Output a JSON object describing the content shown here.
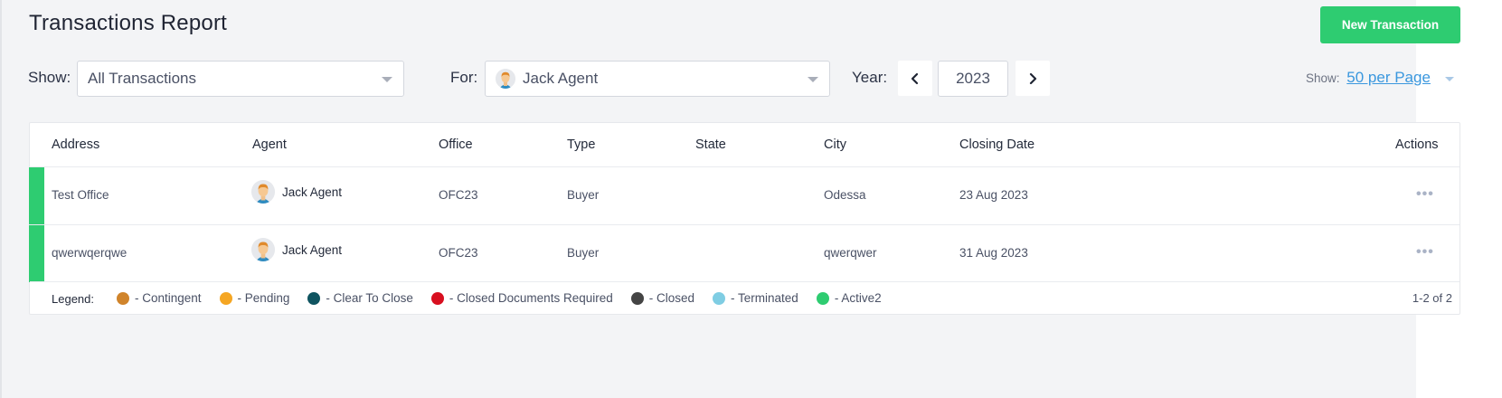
{
  "page": {
    "title": "Transactions Report"
  },
  "toolbar": {
    "new_label": "New Transaction"
  },
  "filters": {
    "show_label": "Show:",
    "show_value": "All Transactions",
    "for_label": "For:",
    "for_value": "Jack Agent",
    "year_label": "Year:",
    "year_value": "2023",
    "per_page_prefix": "Show:",
    "per_page_value": "50 per Page"
  },
  "table": {
    "columns": [
      "Address",
      "Agent",
      "Office",
      "Type",
      "State",
      "City",
      "Closing Date",
      "Actions"
    ],
    "rows": [
      {
        "address": "Test Office",
        "agent": "Jack Agent",
        "office": "OFC23",
        "type": "Buyer",
        "state": "",
        "city": "Odessa",
        "closing_date": "23 Aug 2023",
        "status_color": "#2ecc71"
      },
      {
        "address": "qwerwqerqwe",
        "agent": "Jack Agent",
        "office": "OFC23",
        "type": "Buyer",
        "state": "",
        "city": "qwerqwer",
        "closing_date": "31 Aug 2023",
        "status_color": "#2ecc71"
      }
    ],
    "actions_icon": "more-horizontal-icon"
  },
  "legend": {
    "label": "Legend:",
    "items": [
      {
        "label": "- Contingent",
        "color": "#d0842b"
      },
      {
        "label": "- Pending",
        "color": "#f5a623"
      },
      {
        "label": "- Clear To Close",
        "color": "#0f5460"
      },
      {
        "label": "- Closed Documents Required",
        "color": "#d80f1f"
      },
      {
        "label": "- Closed",
        "color": "#444444"
      },
      {
        "label": "- Terminated",
        "color": "#7fcde3"
      },
      {
        "label": "- Active2",
        "color": "#2ecc71"
      }
    ]
  },
  "pagination": {
    "summary": "1-2 of 2"
  },
  "icons": {
    "prev": "chevron-left-icon",
    "next": "chevron-right-icon",
    "caret": "caret-down-icon",
    "avatar": "agent-avatar-icon"
  }
}
